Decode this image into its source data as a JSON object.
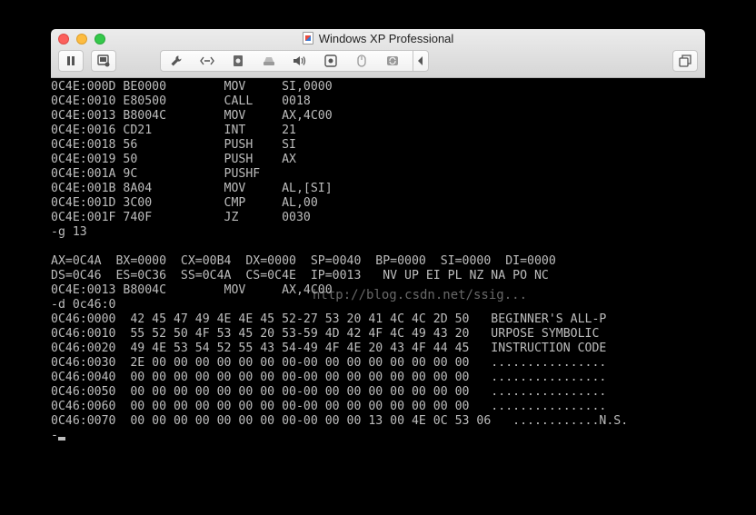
{
  "window": {
    "title": "Windows XP Professional"
  },
  "toolbar": {
    "buttons": [
      {
        "icon": "pause-icon"
      },
      {
        "icon": "snapshot-icon"
      }
    ],
    "device_icons": [
      "wrench-icon",
      "network-icon",
      "drive-icon",
      "disk-icon",
      "sound-icon",
      "camera-icon",
      "mouse-icon",
      "sync-icon"
    ],
    "right_button": {
      "icon": "fullscreen-icon"
    }
  },
  "terminal": {
    "lines": [
      "0C4E:000D BE0000        MOV     SI,0000",
      "0C4E:0010 E80500        CALL    0018",
      "0C4E:0013 B8004C        MOV     AX,4C00",
      "0C4E:0016 CD21          INT     21",
      "0C4E:0018 56            PUSH    SI",
      "0C4E:0019 50            PUSH    AX",
      "0C4E:001A 9C            PUSHF",
      "0C4E:001B 8A04          MOV     AL,[SI]",
      "0C4E:001D 3C00          CMP     AL,00",
      "0C4E:001F 740F          JZ      0030",
      "-g 13",
      "",
      "AX=0C4A  BX=0000  CX=00B4  DX=0000  SP=0040  BP=0000  SI=0000  DI=0000",
      "DS=0C46  ES=0C36  SS=0C4A  CS=0C4E  IP=0013   NV UP EI PL NZ NA PO NC",
      "0C4E:0013 B8004C        MOV     AX,4C00",
      "-d 0c46:0",
      "0C46:0000  42 45 47 49 4E 4E 45 52-27 53 20 41 4C 4C 2D 50   BEGINNER'S ALL-P",
      "0C46:0010  55 52 50 4F 53 45 20 53-59 4D 42 4F 4C 49 43 20   URPOSE SYMBOLIC",
      "0C46:0020  49 4E 53 54 52 55 43 54-49 4F 4E 20 43 4F 44 45   INSTRUCTION CODE",
      "0C46:0030  2E 00 00 00 00 00 00 00-00 00 00 00 00 00 00 00   ................",
      "0C46:0040  00 00 00 00 00 00 00 00-00 00 00 00 00 00 00 00   ................",
      "0C46:0050  00 00 00 00 00 00 00 00-00 00 00 00 00 00 00 00   ................",
      "0C46:0060  00 00 00 00 00 00 00 00-00 00 00 00 00 00 00 00   ................",
      "0C46:0070  00 00 00 00 00 00 00 00-00 00 00 13 00 4E 0C 53 06   ............N.S.",
      "-"
    ],
    "watermark": "http://blog.csdn.net/ssig..."
  },
  "colors": {
    "terminal_bg": "#000000",
    "terminal_fg": "#bdbdbd",
    "close": "#fc605c",
    "minimize": "#fdbc40",
    "zoom": "#34c84a"
  }
}
